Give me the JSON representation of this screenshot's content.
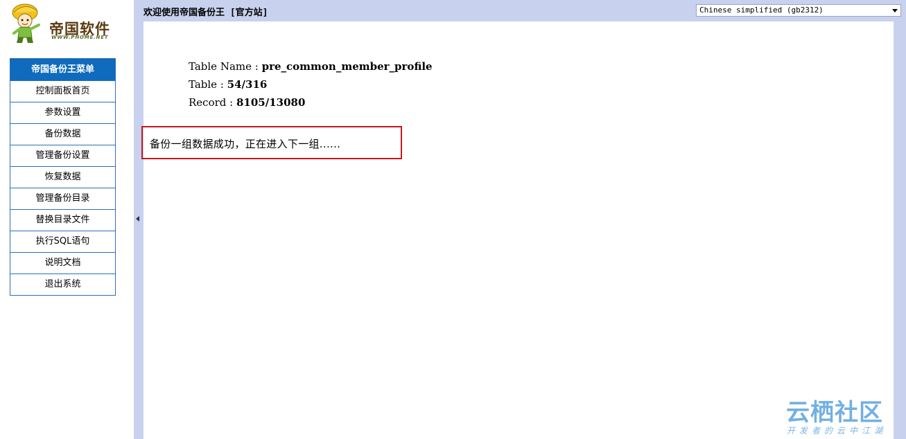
{
  "logo": {
    "name": "帝国软件",
    "url": "WWW.PHOME.NET"
  },
  "menu": {
    "title": "帝国备份王菜单",
    "items": [
      "控制面板首页",
      "参数设置",
      "备份数据",
      "管理备份设置",
      "恢复数据",
      "管理备份目录",
      "替换目录文件",
      "执行SQL语句",
      "说明文档",
      "退出系统"
    ]
  },
  "header": {
    "welcome": "欢迎使用帝国备份王 [官方站]",
    "language_selected": "Chinese simplified (gb2312)"
  },
  "content": {
    "table_name_label": "Table Name : ",
    "table_name_value": "pre_common_member_profile",
    "table_label": "Table : ",
    "table_value": "54/316",
    "record_label": "Record : ",
    "record_value": "8105/13080",
    "message": "备份一组数据成功，正在进入下一组......"
  },
  "watermark": {
    "title": "云栖社区",
    "subtitle": "开发者的云中江湖"
  },
  "colors": {
    "menu_header_bg": "#0e6bbd",
    "panel_bg": "#c8d2ef",
    "highlight_border": "#c8161d",
    "watermark": "#5aa3df"
  }
}
